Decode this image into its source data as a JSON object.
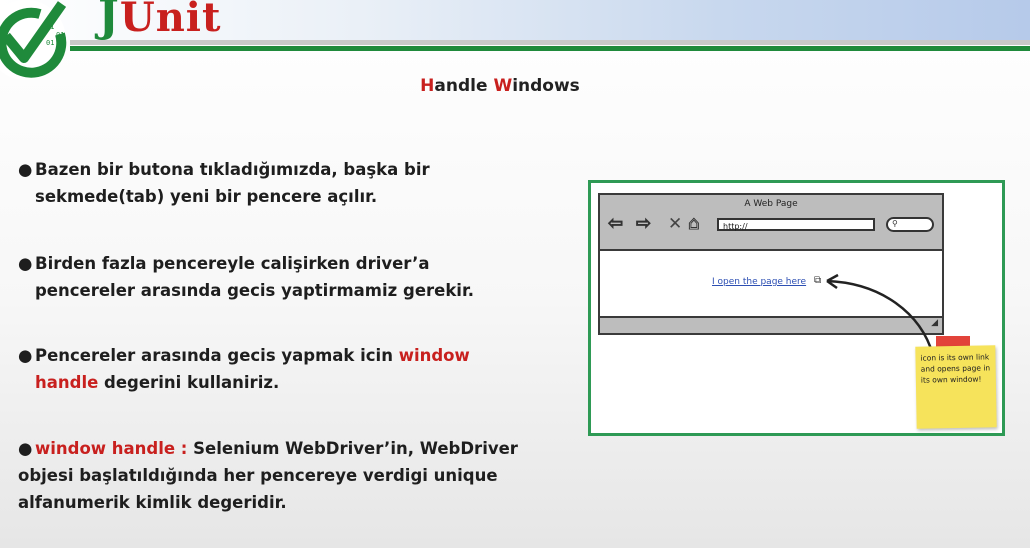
{
  "header": {
    "brand_initial": "J",
    "brand_rest": "Unit",
    "logo_bits": [
      "01",
      "01",
      "01"
    ],
    "accent_green": "#1f8a3b",
    "accent_red": "#c8201e"
  },
  "slide": {
    "title_h": "H",
    "title_rest1": "andle ",
    "title_w": "W",
    "title_rest2": "indows"
  },
  "bullets": [
    {
      "dot": "●",
      "line1": "Bazen bir butona tıkladığımızda, başka bir",
      "line2": "sekmede(tab) yeni bir pencere açılır."
    },
    {
      "dot": "●",
      "line1": "Birden fazla pencereyle calişirken driver’a",
      "line2": "pencereler arasında gecis yaptirmamiz gerekir."
    },
    {
      "dot": "●",
      "line1": "Pencereler arasında gecis yapmak icin",
      "line1_red": "window",
      "line2_red": "handle",
      "line2": "degerini kullaniriz."
    },
    {
      "dot": "●",
      "red": "window handle :",
      "line1": "Selenium WebDriver’in, WebDriver",
      "line2": "objesi başlatıldığında her pencereye verdigi unique",
      "line3": "alfanumerik kimlik degeridir."
    }
  ],
  "mockup": {
    "page_title": "A Web Page",
    "url": "http://",
    "link_text": "I open the page here",
    "icons": [
      "back-arrow-icon",
      "forward-arrow-icon",
      "close-x-icon",
      "home-icon",
      "search-icon",
      "new-window-icon",
      "resize-grip-icon"
    ],
    "note_text": "icon is its own link and opens page in its own window!",
    "border_color": "#2e9a55"
  }
}
